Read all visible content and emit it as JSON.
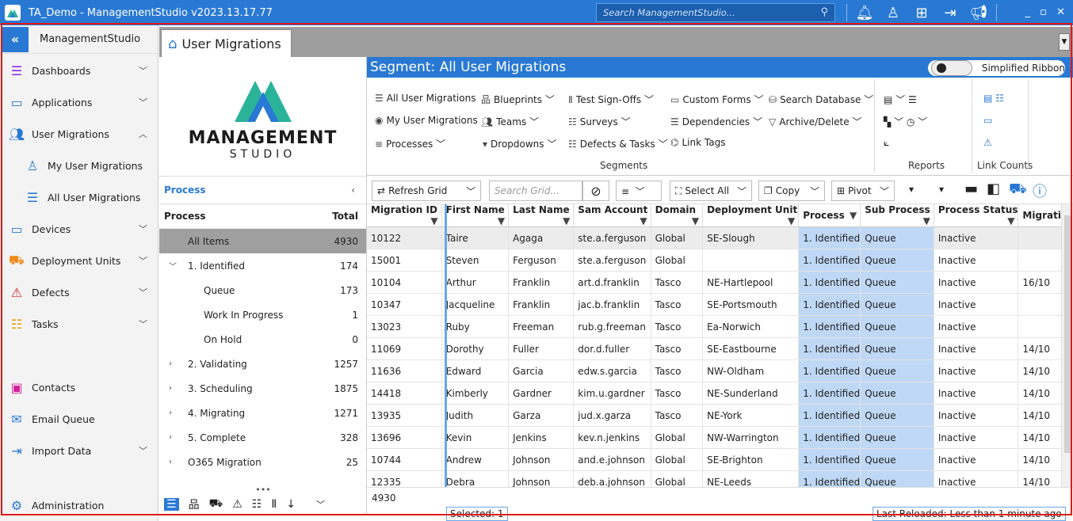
{
  "titlebar": {
    "title": "TA_Demo - ManagementStudio v2023.13.17.77",
    "search_placeholder": "Search ManagementStudio..."
  },
  "sidebar": {
    "title": "ManagementStudio",
    "items": [
      {
        "label": "Dashboards",
        "icon": "dashboard-icon"
      },
      {
        "label": "Applications",
        "icon": "applications-icon"
      },
      {
        "label": "User Migrations",
        "icon": "users-icon"
      },
      {
        "label": "My User Migrations",
        "icon": "user-check-icon"
      },
      {
        "label": "All User Migrations",
        "icon": "list-icon"
      },
      {
        "label": "Devices",
        "icon": "monitor-icon"
      },
      {
        "label": "Deployment Units",
        "icon": "deployment-icon"
      },
      {
        "label": "Defects",
        "icon": "warning-icon"
      },
      {
        "label": "Tasks",
        "icon": "tasks-icon"
      },
      {
        "label": "Contacts",
        "icon": "contacts-icon"
      },
      {
        "label": "Email Queue",
        "icon": "email-icon"
      },
      {
        "label": "Import Data",
        "icon": "import-icon"
      },
      {
        "label": "Administration",
        "icon": "gears-icon"
      }
    ]
  },
  "tab": {
    "label": "User Migrations"
  },
  "brand": {
    "line1": "MANAGEMENT",
    "line2": "STUDIO"
  },
  "process_panel": {
    "title": "Process",
    "col_process": "Process",
    "col_total": "Total",
    "rows": [
      {
        "label": "All Items",
        "count": "4930"
      },
      {
        "label": "1. Identified",
        "count": "174"
      },
      {
        "label": "Queue",
        "count": "173"
      },
      {
        "label": "Work In Progress",
        "count": "1"
      },
      {
        "label": "On Hold",
        "count": "0"
      },
      {
        "label": "2. Validating",
        "count": "1257"
      },
      {
        "label": "3. Scheduling",
        "count": "1875"
      },
      {
        "label": "4. Migrating",
        "count": "1271"
      },
      {
        "label": "5. Complete",
        "count": "328"
      },
      {
        "label": "O365 Migration",
        "count": "25"
      }
    ]
  },
  "ribbon": {
    "segment_title": "Segment: All User Migrations",
    "simplified": "Simplified Ribbon",
    "buttons": [
      "All User Migrations",
      "My User Migrations",
      "Processes",
      "Blueprints",
      "Teams",
      "Dropdowns",
      "Test Sign-Offs",
      "Surveys",
      "Defects & Tasks",
      "Custom Forms",
      "Dependencies",
      "Link Tags",
      "Search Database",
      "Archive/Delete"
    ],
    "groups": [
      "Segments",
      "Reports",
      "Link Counts"
    ]
  },
  "gridbar": {
    "refresh": "Refresh Grid",
    "search_placeholder": "Search Grid...",
    "select_all": "Select All",
    "copy": "Copy",
    "pivot": "Pivot"
  },
  "grid": {
    "columns": [
      "Migration ID",
      "First Name",
      "Last Name",
      "Sam Account",
      "Domain",
      "Deployment Unit",
      "Process",
      "Sub Process",
      "Process Status",
      "Migrati"
    ],
    "rows": [
      [
        "10122",
        "Taire",
        "Agaga",
        "ste.a.ferguson",
        "Global",
        "SE-Slough",
        "1. Identified",
        "Queue",
        "Inactive",
        ""
      ],
      [
        "15001",
        "Steven",
        "Ferguson",
        "ste.a.ferguson",
        "Global",
        "",
        "1. Identified",
        "Queue",
        "Inactive",
        ""
      ],
      [
        "10104",
        "Arthur",
        "Franklin",
        "art.d.franklin",
        "Tasco",
        "NE-Hartlepool",
        "1. Identified",
        "Queue",
        "Inactive",
        "16/10"
      ],
      [
        "10347",
        "Jacqueline",
        "Franklin",
        "jac.b.franklin",
        "Tasco",
        "SE-Portsmouth",
        "1. Identified",
        "Queue",
        "Inactive",
        ""
      ],
      [
        "13023",
        "Ruby",
        "Freeman",
        "rub.g.freeman",
        "Tasco",
        "Ea-Norwich",
        "1. Identified",
        "Queue",
        "Inactive",
        ""
      ],
      [
        "11069",
        "Dorothy",
        "Fuller",
        "dor.d.fuller",
        "Tasco",
        "SE-Eastbourne",
        "1. Identified",
        "Queue",
        "Inactive",
        "14/10"
      ],
      [
        "11636",
        "Edward",
        "Garcia",
        "edw.s.garcia",
        "Tasco",
        "NW-Oldham",
        "1. Identified",
        "Queue",
        "Inactive",
        "14/10"
      ],
      [
        "14418",
        "Kimberly",
        "Gardner",
        "kim.u.gardner",
        "Tasco",
        "NE-Sunderland",
        "1. Identified",
        "Queue",
        "Inactive",
        "14/10"
      ],
      [
        "13935",
        "Judith",
        "Garza",
        "jud.x.garza",
        "Tasco",
        "NE-York",
        "1. Identified",
        "Queue",
        "Inactive",
        "14/10"
      ],
      [
        "13696",
        "Kevin",
        "Jenkins",
        "kev.n.jenkins",
        "Global",
        "NW-Warrington",
        "1. Identified",
        "Queue",
        "Inactive",
        "14/10"
      ],
      [
        "10744",
        "Andrew",
        "Johnson",
        "and.e.johnson",
        "Global",
        "SE-Brighton",
        "1. Identified",
        "Queue",
        "Inactive",
        "14/10"
      ],
      [
        "12335",
        "Debra",
        "Johnson",
        "deb.a.johnson",
        "Global",
        "NE-Leeds",
        "1. Identified",
        "Queue",
        "Inactive",
        "14/10"
      ]
    ]
  },
  "footer": {
    "total": "4930",
    "selected": "Selected: 1",
    "reloaded": "Last Reloaded: Less than 1 minute ago"
  }
}
